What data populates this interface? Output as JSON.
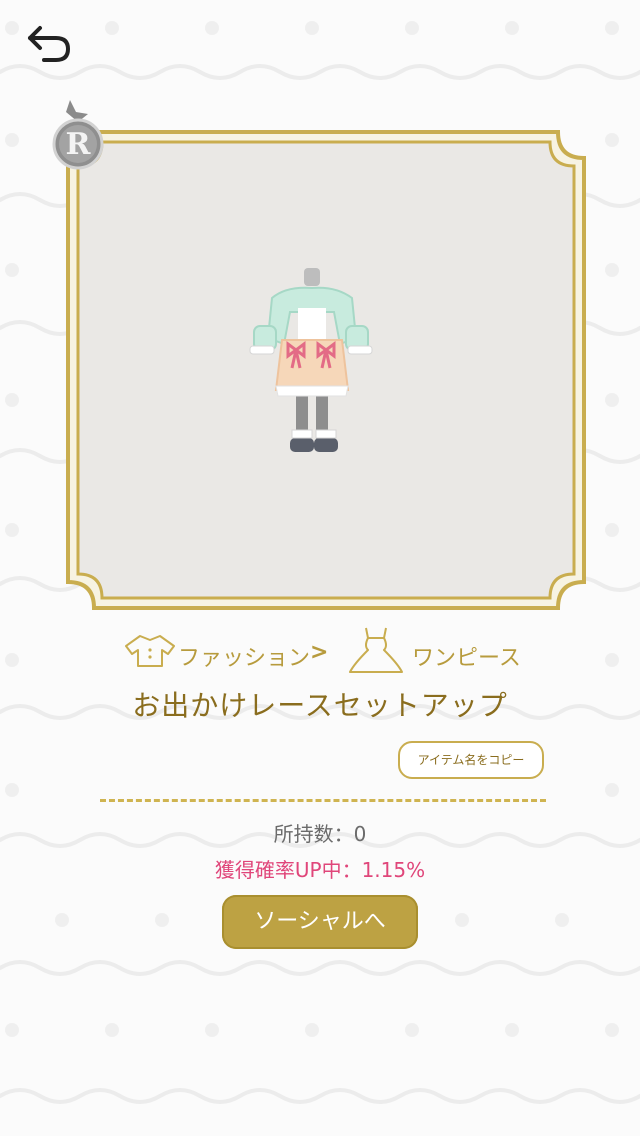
{
  "header": {
    "back_icon": "back-arrow-icon"
  },
  "item": {
    "rarity": "R",
    "image_alt": "outfit-preview",
    "name": "お出かけレースセットアップ",
    "copy_label": "アイテム名をコピー",
    "owned_label": "所持数：0",
    "rate_label": "獲得確率UP中：1.15%"
  },
  "breadcrumb": {
    "category": "ファッション",
    "separator": ">",
    "subcategory": "ワンピース",
    "category_icon": "shirt-icon",
    "subcategory_icon": "dress-icon"
  },
  "actions": {
    "social_label": "ソーシャルへ"
  },
  "colors": {
    "gold": "#c9ad4f",
    "gold_dark": "#8a6d1e",
    "accent_pink": "#e0467a",
    "button_gold": "#bda243",
    "frame_bg": "#eae8e5"
  }
}
